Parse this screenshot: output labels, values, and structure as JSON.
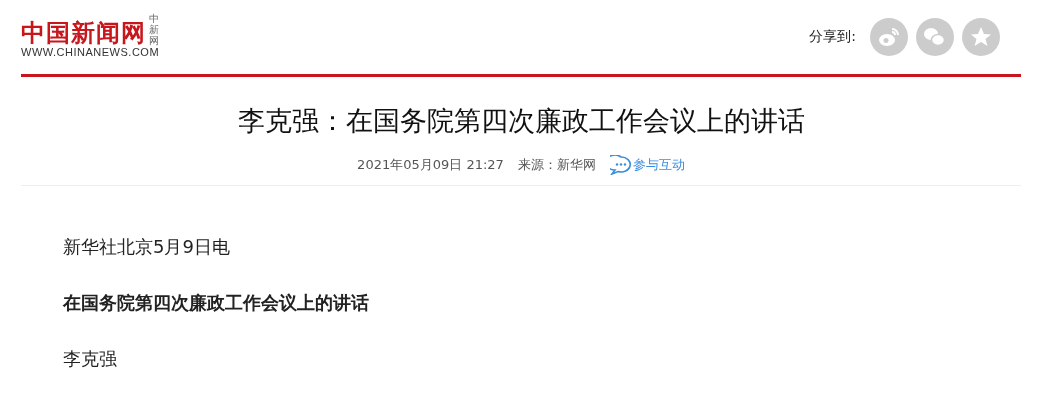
{
  "logo": {
    "name": "中国新闻网",
    "small": "中新网",
    "url": "WWW.CHINANEWS.COM"
  },
  "share": {
    "label": "分享到:"
  },
  "article": {
    "title": "李克强：在国务院第四次廉政工作会议上的讲话",
    "date": "2021年05月09日 21:27",
    "source": "来源：新华网",
    "interact": "参与互动",
    "paragraphs": [
      {
        "text": "新华社北京5月9日电",
        "kind": "plain"
      },
      {
        "text": "在国务院第四次廉政工作会议上的讲话",
        "kind": "heading"
      },
      {
        "text": "李克强",
        "kind": "plain"
      }
    ]
  }
}
